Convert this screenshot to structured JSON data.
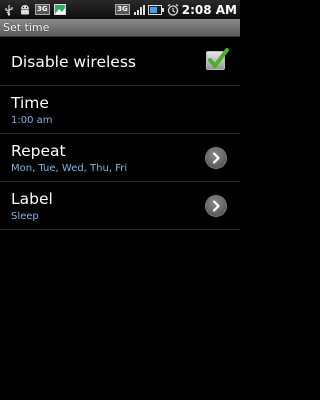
{
  "status_bar": {
    "network_badge": "3G",
    "network_badge_right": "3G",
    "clock": "2:08 AM",
    "icons": [
      "usb-icon",
      "android-debug-icon",
      "3g-badge-icon",
      "image-icon",
      "3g-data-icon",
      "signal-icon",
      "battery-icon",
      "alarm-icon"
    ]
  },
  "title_bar": {
    "title": "Set time"
  },
  "settings": [
    {
      "title": "Disable wireless",
      "checked": true
    },
    {
      "title": "Time",
      "summary": "1:00 am"
    },
    {
      "title": "Repeat",
      "summary": "Mon, Tue, Wed, Thu, Fri",
      "icon": "chevron-right-icon"
    },
    {
      "title": "Label",
      "summary": "Sleep",
      "icon": "chevron-right-icon"
    }
  ],
  "colors": {
    "background": "#000000",
    "summary_text": "#7fb5e6",
    "checkmark": "#4caf2a",
    "title_bar": "#6e6e6e"
  }
}
